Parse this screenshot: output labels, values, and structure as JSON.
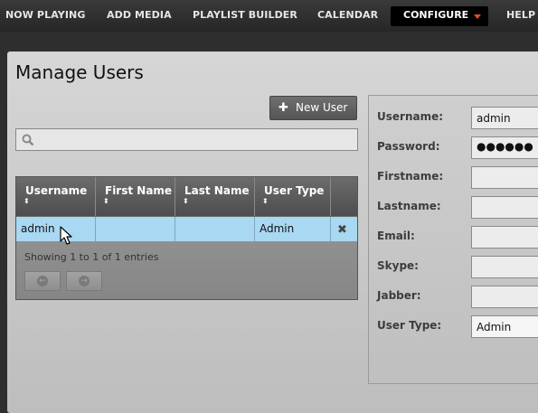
{
  "nav": {
    "items": [
      "NOW PLAYING",
      "ADD MEDIA",
      "PLAYLIST BUILDER",
      "CALENDAR",
      "HELP"
    ],
    "active": "CONFIGURE"
  },
  "page": {
    "title": "Manage Users"
  },
  "toolbar": {
    "new_user_label": "New User",
    "plus_glyph": "✚"
  },
  "search": {
    "placeholder": "",
    "value": ""
  },
  "table": {
    "columns": [
      "Username",
      "First Name",
      "Last Name",
      "User Type"
    ],
    "sort_glyph": "⬍",
    "rows": [
      {
        "username": "admin",
        "first_name": "",
        "last_name": "",
        "user_type": "Admin",
        "delete_glyph": "✖"
      }
    ],
    "info": "Showing 1 to 1 of 1 entries",
    "prev_glyph": "←",
    "next_glyph": "→"
  },
  "form": {
    "labels": [
      "Username:",
      "Password:",
      "Firstname:",
      "Lastname:",
      "Email:",
      "Skype:",
      "Jabber:",
      "User Type:"
    ],
    "values": {
      "username": "admin",
      "password": "●●●●●●",
      "firstname": "",
      "lastname": "",
      "email": "",
      "skype": "",
      "jabber": "",
      "user_type": "Admin"
    }
  },
  "colors": {
    "accent": "#e0531e",
    "row_selected": "#a8d8f2"
  }
}
